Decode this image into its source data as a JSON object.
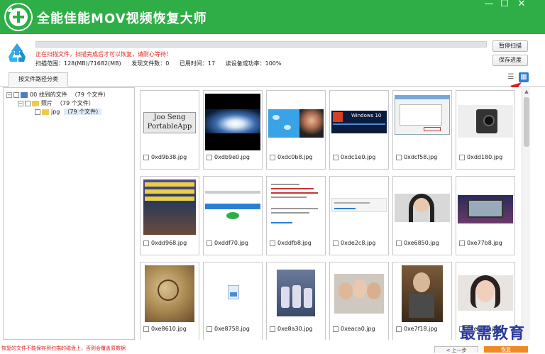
{
  "window": {
    "title": "全能佳能MOV视频恢复大师",
    "minimize_label": "—",
    "maximize_label": "☐",
    "close_label": "✕"
  },
  "scan": {
    "progress": 1.0,
    "warning": "正在扫描文件，扫描完成后才可以恢复，请耐心等待！",
    "range": "扫描范围：128(MB)/71682(MB)",
    "files_found": "发现文件数：0",
    "time_used": "已用时间：17",
    "read_success": "读设备成功率：100%",
    "pause_label": "暂停扫描",
    "save_label": "保存进度"
  },
  "tabs": [
    {
      "label": "按文件路径分类"
    }
  ],
  "view_modes": [
    {
      "icon": "list-view-icon",
      "active": false
    },
    {
      "icon": "grid-view-icon",
      "active": true
    }
  ],
  "tree": {
    "root": {
      "label": "00 找到的文件",
      "count": "（79 个文件）"
    },
    "child": {
      "label": "照片",
      "count": "（79 个文件）"
    },
    "leaf": {
      "label": "jpg",
      "count": "（79 个文件）"
    }
  },
  "files": [
    {
      "name": "0xd9b38.jpg",
      "thumb": "joo-seng-logo"
    },
    {
      "name": "0xdb9e0.jpg",
      "thumb": "hurricane"
    },
    {
      "name": "0xdc0b8.jpg",
      "thumb": "twitter-birds-portrait"
    },
    {
      "name": "0xdc1e0.jpg",
      "thumb": "windows-10"
    },
    {
      "name": "0xdcf58.jpg",
      "thumb": "dialog-window"
    },
    {
      "name": "0xdd180.jpg",
      "thumb": "camera"
    },
    {
      "name": "0xdd968.jpg",
      "thumb": "video-poster"
    },
    {
      "name": "0xddf70.jpg",
      "thumb": "webpage"
    },
    {
      "name": "0xddfb8.jpg",
      "thumb": "text-document"
    },
    {
      "name": "0xde2c8.jpg",
      "thumb": "blank-page"
    },
    {
      "name": "0xe6850.jpg",
      "thumb": "woman-portrait"
    },
    {
      "name": "0xe77b8.jpg",
      "thumb": "laptop"
    },
    {
      "name": "0xe8610.jpg",
      "thumb": "old-map"
    },
    {
      "name": "0xe8758.jpg",
      "thumb": "image-placeholder"
    },
    {
      "name": "0xe8a30.jpg",
      "thumb": "astronauts"
    },
    {
      "name": "0xeaca0.jpg",
      "thumb": "selfie"
    },
    {
      "name": "0xe7f18.jpg",
      "thumb": "old-man"
    },
    {
      "name": "0xe8f70.jpg",
      "thumb": "woman-face"
    }
  ],
  "thumb_text": {
    "joo_seng_line1": "Joo Seng",
    "joo_seng_line2": "PortableApp",
    "windows": "Windows 10"
  },
  "bottom": {
    "hint": "恢复的文件不能保存到扫描的磁盘上，否则会覆盖原数据",
    "back_label": "< 上一步",
    "next_label": "恢复"
  },
  "watermark": "最需教育",
  "colors": {
    "accent_green": "#2fae47",
    "warning_red": "#e02020",
    "active_view": "#2a7fd4",
    "arrow_red": "#d42020"
  }
}
